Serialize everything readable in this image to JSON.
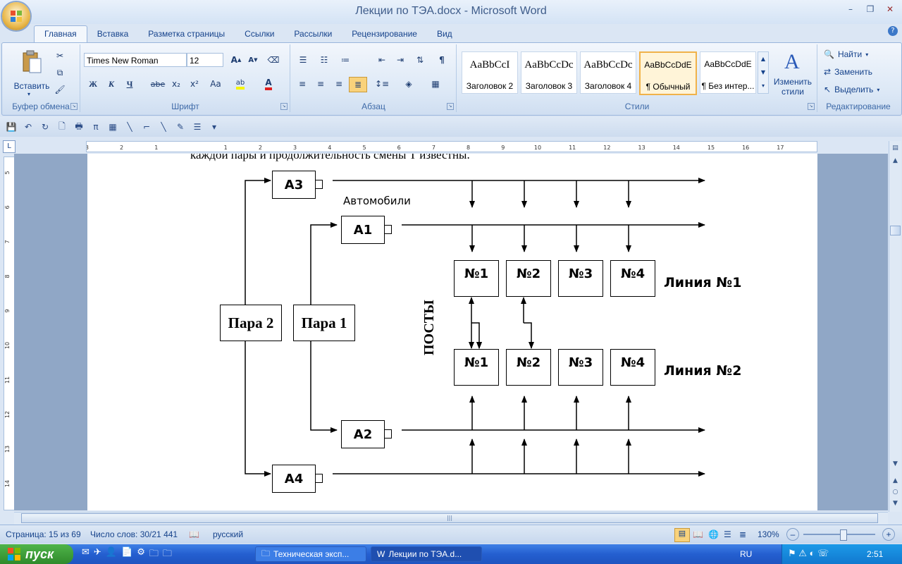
{
  "window": {
    "title": "Лекции по  ТЭА.docx - Microsoft Word",
    "min": "–",
    "restore": "❐",
    "close": "✕"
  },
  "qat_top": [
    "save-icon",
    "undo-icon",
    "redo-icon"
  ],
  "tabs": [
    {
      "label": "Главная",
      "active": true
    },
    {
      "label": "Вставка"
    },
    {
      "label": "Разметка страницы"
    },
    {
      "label": "Ссылки"
    },
    {
      "label": "Рассылки"
    },
    {
      "label": "Рецензирование"
    },
    {
      "label": "Вид"
    }
  ],
  "ribbon": {
    "clipboard": {
      "label": "Буфер обмена",
      "paste": "Вставить"
    },
    "font": {
      "label": "Шрифт",
      "family": "Times New Roman",
      "size": "12",
      "bold": "Ж",
      "italic": "К",
      "underline": "Ч",
      "strike": "abe",
      "sub": "x₂",
      "sup": "x²",
      "case": "Aa",
      "grow": "A",
      "shrink": "A"
    },
    "paragraph": {
      "label": "Абзац"
    },
    "styles": {
      "label": "Стили",
      "items": [
        {
          "sample": "AaBbCcI",
          "name": "Заголовок 2"
        },
        {
          "sample": "AaBbCcDc",
          "name": "Заголовок 3"
        },
        {
          "sample": "AaBbCcDc",
          "name": "Заголовок 4"
        },
        {
          "sample": "AaBbCcDdE",
          "name": "¶ Обычный",
          "selected": true
        },
        {
          "sample": "AaBbCcDdE",
          "name": "¶ Без интер..."
        }
      ],
      "change": "Изменить стили"
    },
    "editing": {
      "label": "Редактирование",
      "find": "Найти",
      "replace": "Заменить",
      "select": "Выделить"
    }
  },
  "ruler": {
    "h_ticks": [
      "3",
      "2",
      "1",
      "1",
      "2",
      "3",
      "4",
      "5",
      "6",
      "7",
      "8",
      "9",
      "10",
      "11",
      "12",
      "13",
      "14",
      "15",
      "16",
      "17"
    ],
    "v_ticks": [
      "5",
      "6",
      "7",
      "8",
      "9",
      "10",
      "11",
      "12",
      "13",
      "14"
    ]
  },
  "document": {
    "line": "каждой пары и продолжительность смены Т известны.",
    "diagram": {
      "cars": [
        "А3",
        "А1",
        "А2",
        "А4"
      ],
      "cars_label": "Автомобили",
      "pairs": [
        "Пара 2",
        "Пара 1"
      ],
      "posts_label": "ПОСТЫ",
      "line1": {
        "label": "Линия №1",
        "posts": [
          "№1",
          "№2",
          "№3",
          "№4"
        ]
      },
      "line2": {
        "label": "Линия №2",
        "posts": [
          "№1",
          "№2",
          "№3",
          "№4"
        ]
      }
    }
  },
  "status": {
    "page": "Страница: 15 из 69",
    "words": "Число слов: 30/21 441",
    "lang": "русский",
    "zoom": "130%"
  },
  "taskbar": {
    "start": "пуск",
    "tasks": [
      "Техническая эксп...",
      "Лекции по  ТЭА.d..."
    ],
    "lang": "RU",
    "time": "2:51"
  }
}
